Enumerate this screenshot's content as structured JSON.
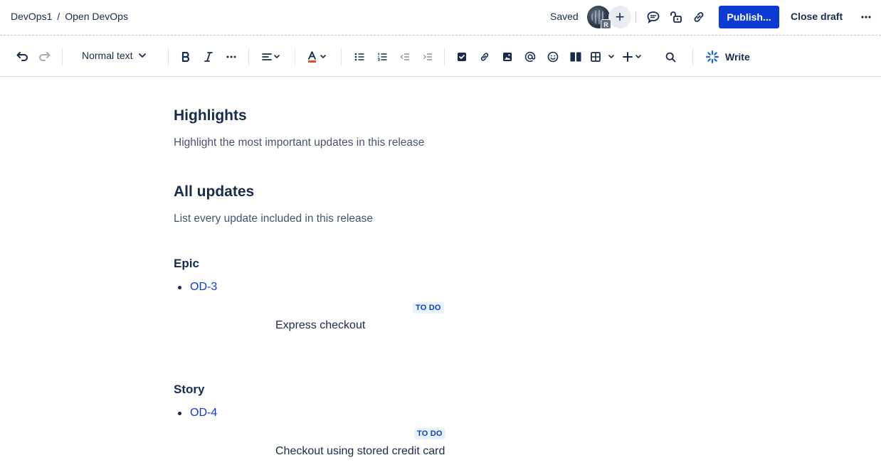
{
  "breadcrumb": {
    "space": "DevOps1",
    "separator": "/",
    "page": "Open DevOps"
  },
  "header": {
    "saved_label": "Saved",
    "avatar_initial": "R",
    "add_collaborator": "+",
    "publish_label": "Publish...",
    "close_draft_label": "Close draft",
    "accent_color": "#0c3bd3"
  },
  "toolbar": {
    "text_style": "Normal text",
    "write_label": "Write",
    "icons": [
      "undo-icon",
      "redo-icon",
      "bold-icon",
      "italic-icon",
      "more-formatting-icon",
      "align-icon",
      "text-color-icon",
      "bullet-list-icon",
      "numbered-list-icon",
      "outdent-icon",
      "indent-icon",
      "action-item-icon",
      "link-icon",
      "image-icon",
      "mention-icon",
      "emoji-icon",
      "layout-icon",
      "table-icon",
      "insert-icon",
      "find-icon",
      "ai-write-icon"
    ]
  },
  "document": {
    "highlights_heading": "Highlights",
    "highlights_text": "Highlight the most important updates in this release",
    "all_updates_heading": "All updates",
    "all_updates_text": "List every update included in this release",
    "sections": [
      {
        "heading": "Epic",
        "issue_key": "OD-3",
        "status": "TO DO",
        "summary": "Express checkout"
      },
      {
        "heading": "Story",
        "issue_key": "OD-4",
        "status": "TO DO",
        "summary": "Checkout using stored credit card"
      }
    ]
  }
}
